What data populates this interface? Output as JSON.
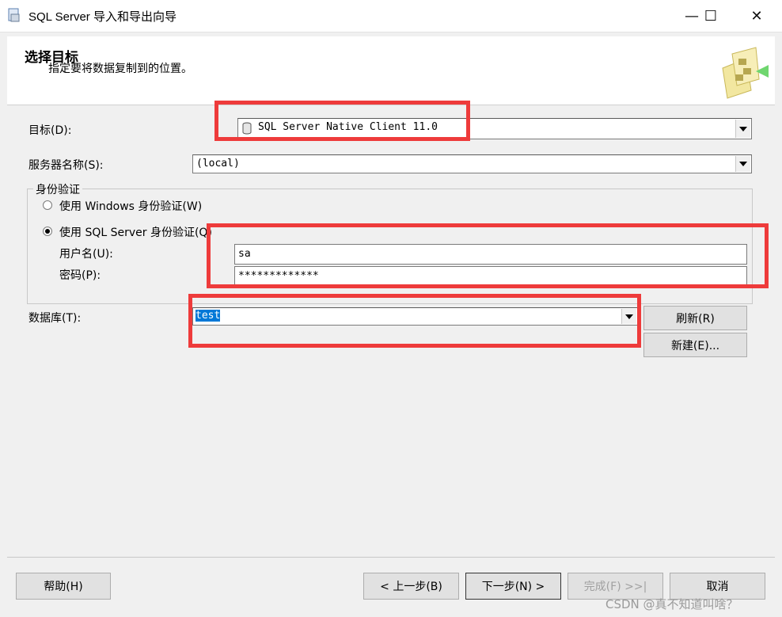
{
  "window": {
    "title": "SQL Server 导入和导出向导",
    "minimize": "—",
    "maximize": "☐",
    "close": "✕"
  },
  "header": {
    "title": "选择目标",
    "subtitle": "指定要将数据复制到的位置。"
  },
  "form": {
    "destination_label": "目标(D):",
    "destination_value": "SQL Server Native Client 11.0",
    "server_label": "服务器名称(S):",
    "server_value": "(local)",
    "auth_group_label": "身份验证",
    "auth_windows_label": "使用 Windows 身份验证(W)",
    "auth_sql_label": "使用 SQL Server 身份验证(Q)",
    "auth_selected": "sql",
    "username_label": "用户名(U):",
    "username_value": "sa",
    "password_label": "密码(P):",
    "password_value": "*************",
    "database_label": "数据库(T):",
    "database_value": "test",
    "refresh_button": "刷新(R)",
    "new_button": "新建(E)..."
  },
  "footer": {
    "help_button": "帮助(H)",
    "back_button": "< 上一步(B)",
    "next_button": "下一步(N) >",
    "finish_button": "完成(F) >>|",
    "cancel_button": "取消"
  },
  "watermark": "CSDN @真不知道叫啥？",
  "colors": {
    "highlight_box": "#ee3b3b",
    "selection": "#0078d7",
    "background": "#f0f0f0"
  }
}
